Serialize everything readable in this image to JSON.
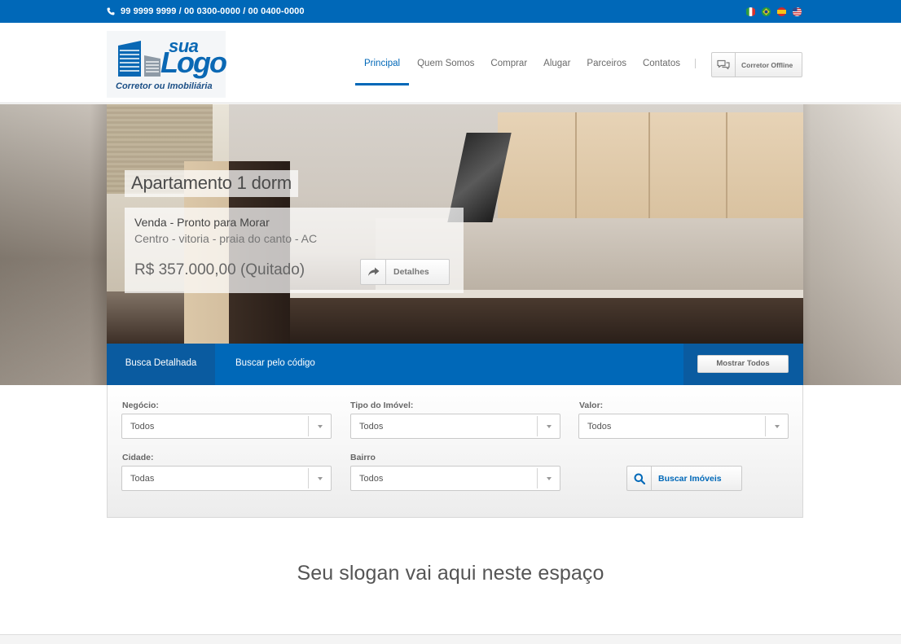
{
  "topbar": {
    "phone": "99 9999 9999 / 00 0300-0000 / 00 0400-0000",
    "flags": [
      "flag-italy",
      "flag-brazil",
      "flag-spain",
      "flag-usa"
    ]
  },
  "logo": {
    "line1": "sua",
    "line2": "Logo",
    "tagline": "Corretor ou Imobiliária"
  },
  "nav": {
    "items": [
      "Principal",
      "Quem Somos",
      "Comprar",
      "Alugar",
      "Parceiros",
      "Contatos"
    ],
    "active": "Principal"
  },
  "corretor": {
    "label": "Corretor Offline",
    "icon": "chat-icon"
  },
  "hero": {
    "title": "Apartamento 1 dorm",
    "type": "Venda - Pronto para Morar",
    "location": "Centro - vitoria - praia do canto - AC",
    "price": "R$ 357.000,00 (Quitado)",
    "details_button": "Detalhes"
  },
  "search": {
    "tabs": [
      "Busca Detalhada",
      "Buscar pelo código"
    ],
    "active_tab": "Busca Detalhada",
    "show_all": "Mostrar Todos",
    "fields": {
      "negocio": {
        "label": "Negócio:",
        "value": "Todos"
      },
      "tipo": {
        "label": "Tipo do Imóvel:",
        "value": "Todos"
      },
      "valor": {
        "label": "Valor:",
        "value": "Todos"
      },
      "cidade": {
        "label": "Cidade:",
        "value": "Todas"
      },
      "bairro": {
        "label": "Bairro",
        "value": "Todos"
      }
    },
    "submit": "Buscar Imóveis"
  },
  "slogan": "Seu slogan vai aqui neste espaço",
  "colors": {
    "primary": "#0068b8",
    "primary_dark": "#0a5ba0"
  }
}
